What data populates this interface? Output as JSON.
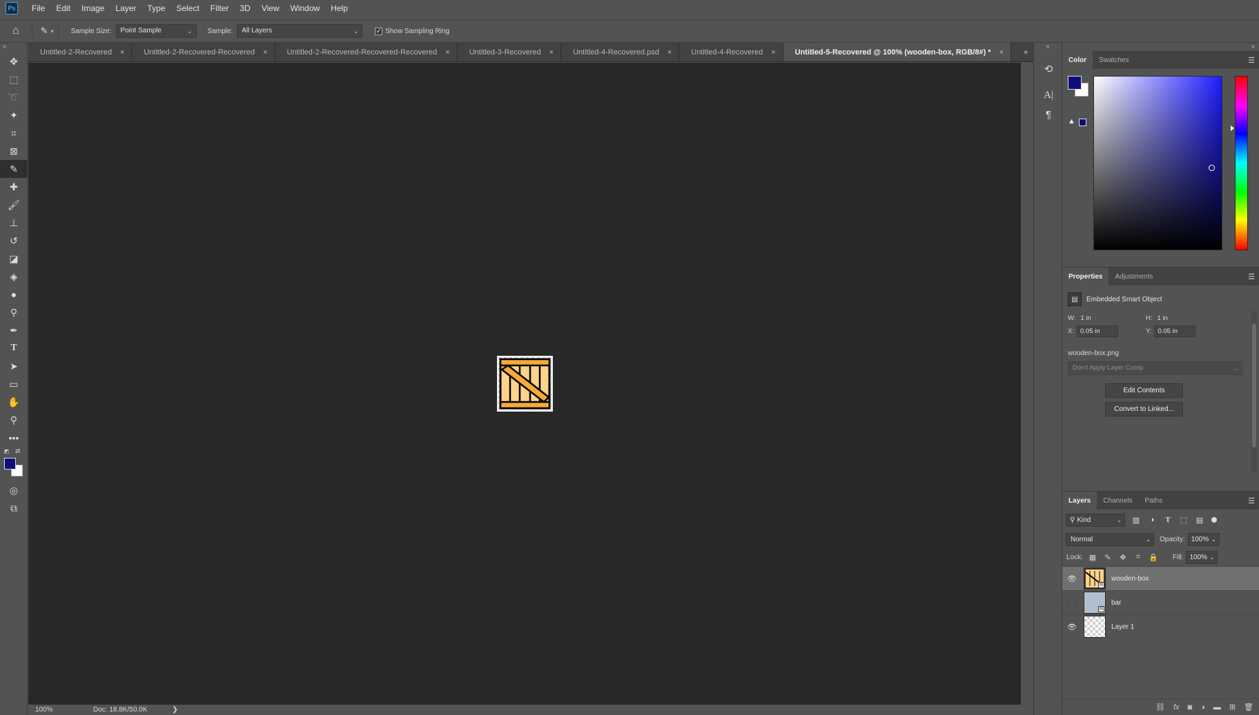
{
  "app": {
    "logo": "Ps"
  },
  "menu": [
    "File",
    "Edit",
    "Image",
    "Layer",
    "Type",
    "Select",
    "Filter",
    "3D",
    "View",
    "Window",
    "Help"
  ],
  "options": {
    "sample_size_label": "Sample Size:",
    "sample_size_value": "Point Sample",
    "sample_label": "Sample:",
    "sample_value": "All Layers",
    "show_sampling_ring_label": "Show Sampling Ring",
    "show_sampling_ring_checked": true
  },
  "tools": [
    "move-tool-icon",
    "marquee-tool-icon",
    "lasso-tool-icon",
    "magic-wand-icon",
    "crop-tool-icon",
    "frame-tool-icon",
    "eyedropper-tool-icon",
    "healing-brush-icon",
    "brush-tool-icon",
    "clone-stamp-icon",
    "history-brush-icon",
    "eraser-tool-icon",
    "paint-bucket-icon",
    "blur-tool-icon",
    "dodge-tool-icon",
    "pen-tool-icon",
    "type-tool-icon",
    "path-selection-icon",
    "rectangle-tool-icon",
    "hand-tool-icon",
    "zoom-tool-icon",
    "more-tools-icon"
  ],
  "tabs": [
    {
      "label": "Untitled-2-Recovered",
      "active": false
    },
    {
      "label": "Untitled-2-Recovered-Recovered",
      "active": false
    },
    {
      "label": "Untitled-2-Recovered-Recovered-Recovered",
      "active": false
    },
    {
      "label": "Untitled-3-Recovered",
      "active": false
    },
    {
      "label": "Untitled-4-Recovered.psd",
      "active": false
    },
    {
      "label": "Untitled-4-Recovered",
      "active": false
    },
    {
      "label": "Untitled-5-Recovered @ 100% (wooden-box, RGB/8#) *",
      "active": true
    }
  ],
  "status": {
    "zoom": "100%",
    "doc": "Doc: 18.8K/50.0K",
    "arrow": "❯"
  },
  "colors": {
    "foreground": "#0e0e7a",
    "background": "#ffffff",
    "hue": "#1d1dff",
    "accent_blue": "#31a8ff"
  },
  "color_panel": {
    "tabs": [
      "Color",
      "Swatches"
    ],
    "hue_fraction": 0.3,
    "saturation": 0.91,
    "brightness": 0.48
  },
  "properties_panel": {
    "tabs": [
      "Properties",
      "Adjustments"
    ],
    "type_label": "Embedded Smart Object",
    "w_label": "W:",
    "w_value": "1 in",
    "h_label": "H:",
    "h_value": "1 in",
    "x_label": "X:",
    "x_value": "0.05 in",
    "y_label": "Y:",
    "y_value": "0.05 in",
    "file_name": "wooden-box.png",
    "layer_comp": "Don't Apply Layer Comp",
    "edit_contents": "Edit Contents",
    "convert_linked": "Convert to Linked..."
  },
  "layers_panel": {
    "tabs": [
      "Layers",
      "Channels",
      "Paths"
    ],
    "kind": "Kind",
    "blend_mode": "Normal",
    "opacity_label": "Opacity:",
    "opacity": "100%",
    "lock_label": "Lock:",
    "fill_label": "Fill:",
    "fill": "100%",
    "layers": [
      {
        "name": "wooden-box",
        "visible": true,
        "selected": true,
        "smart": true
      },
      {
        "name": "bar",
        "visible": false,
        "selected": false,
        "smart": true
      },
      {
        "name": "Layer 1",
        "visible": true,
        "selected": false,
        "smart": false
      }
    ]
  }
}
